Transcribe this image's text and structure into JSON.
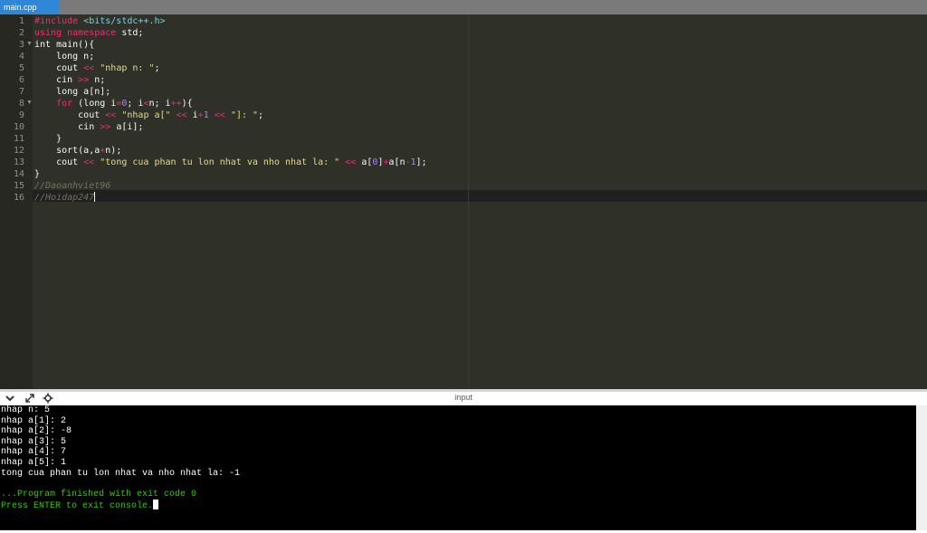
{
  "tab": {
    "label": "main.cpp"
  },
  "line_numbers": [
    "1",
    "2",
    "3",
    "4",
    "5",
    "6",
    "7",
    "8",
    "9",
    "10",
    "11",
    "12",
    "13",
    "14",
    "15",
    "16"
  ],
  "code_lines": [
    [
      {
        "t": "#include ",
        "c": "t-inc"
      },
      {
        "t": "<bits/stdc++.h>",
        "c": "t-hdr"
      }
    ],
    [
      {
        "t": "using ",
        "c": "t-kw"
      },
      {
        "t": "namespace ",
        "c": "t-kw"
      },
      {
        "t": "std;",
        "c": "t-text"
      }
    ],
    [
      {
        "t": "int main(){",
        "c": "t-text"
      }
    ],
    [
      {
        "t": "    long n;",
        "c": "t-text"
      }
    ],
    [
      {
        "t": "    cout ",
        "c": "t-text"
      },
      {
        "t": "<<",
        "c": "t-kw"
      },
      {
        "t": " ",
        "c": "t-text"
      },
      {
        "t": "\"nhap n: \"",
        "c": "t-str"
      },
      {
        "t": ";",
        "c": "t-text"
      }
    ],
    [
      {
        "t": "    cin ",
        "c": "t-text"
      },
      {
        "t": ">>",
        "c": "t-kw"
      },
      {
        "t": " n;",
        "c": "t-text"
      }
    ],
    [
      {
        "t": "    long a[n];",
        "c": "t-text"
      }
    ],
    [
      {
        "t": "    ",
        "c": "t-text"
      },
      {
        "t": "for",
        "c": "t-kw"
      },
      {
        "t": " (long i",
        "c": "t-text"
      },
      {
        "t": "=",
        "c": "t-kw"
      },
      {
        "t": "0",
        "c": "t-num"
      },
      {
        "t": "; i",
        "c": "t-text"
      },
      {
        "t": "<",
        "c": "t-kw"
      },
      {
        "t": "n; i",
        "c": "t-text"
      },
      {
        "t": "++",
        "c": "t-kw"
      },
      {
        "t": "){",
        "c": "t-text"
      }
    ],
    [
      {
        "t": "        cout ",
        "c": "t-text"
      },
      {
        "t": "<<",
        "c": "t-kw"
      },
      {
        "t": " ",
        "c": "t-text"
      },
      {
        "t": "\"nhap a[\"",
        "c": "t-str"
      },
      {
        "t": " ",
        "c": "t-text"
      },
      {
        "t": "<<",
        "c": "t-kw"
      },
      {
        "t": " i",
        "c": "t-text"
      },
      {
        "t": "+",
        "c": "t-kw"
      },
      {
        "t": "1",
        "c": "t-num"
      },
      {
        "t": " ",
        "c": "t-text"
      },
      {
        "t": "<<",
        "c": "t-kw"
      },
      {
        "t": " ",
        "c": "t-text"
      },
      {
        "t": "\"]: \"",
        "c": "t-str"
      },
      {
        "t": ";",
        "c": "t-text"
      }
    ],
    [
      {
        "t": "        cin ",
        "c": "t-text"
      },
      {
        "t": ">>",
        "c": "t-kw"
      },
      {
        "t": " a[i];",
        "c": "t-text"
      }
    ],
    [
      {
        "t": "    }",
        "c": "t-text"
      }
    ],
    [
      {
        "t": "    sort(a,a",
        "c": "t-text"
      },
      {
        "t": "+",
        "c": "t-kw"
      },
      {
        "t": "n);",
        "c": "t-text"
      }
    ],
    [
      {
        "t": "    cout ",
        "c": "t-text"
      },
      {
        "t": "<<",
        "c": "t-kw"
      },
      {
        "t": " ",
        "c": "t-text"
      },
      {
        "t": "\"tong cua phan tu lon nhat va nho nhat la: \"",
        "c": "t-str"
      },
      {
        "t": " ",
        "c": "t-text"
      },
      {
        "t": "<<",
        "c": "t-kw"
      },
      {
        "t": " a[",
        "c": "t-text"
      },
      {
        "t": "0",
        "c": "t-num"
      },
      {
        "t": "]",
        "c": "t-text"
      },
      {
        "t": "+",
        "c": "t-kw"
      },
      {
        "t": "a[n",
        "c": "t-text"
      },
      {
        "t": "-",
        "c": "t-kw"
      },
      {
        "t": "1",
        "c": "t-num"
      },
      {
        "t": "];",
        "c": "t-text"
      }
    ],
    [
      {
        "t": "}",
        "c": "t-text"
      }
    ],
    [
      {
        "t": "//Daoanhviet96",
        "c": "t-com"
      }
    ],
    [
      {
        "t": "//Hoidap247",
        "c": "t-com"
      }
    ]
  ],
  "console": {
    "title": "input",
    "icons": [
      "chevron-down-icon",
      "expand-icon",
      "settings-icon"
    ],
    "output_lines": [
      "nhap n: 5",
      "nhap a[1]: 2",
      "nhap a[2]: -8",
      "nhap a[3]: 5",
      "nhap a[4]: 7",
      "nhap a[5]: 1",
      "tong cua phan tu lon nhat va nho nhat la: -1",
      ""
    ],
    "status_lines": [
      "...Program finished with exit code 0",
      "Press ENTER to exit console."
    ]
  },
  "colors": {
    "editor_bg": "#2f3129",
    "gutter_bg": "#272822",
    "tab_active": "#2f87d6",
    "console_bg": "#000000",
    "console_status": "#33cc00"
  }
}
